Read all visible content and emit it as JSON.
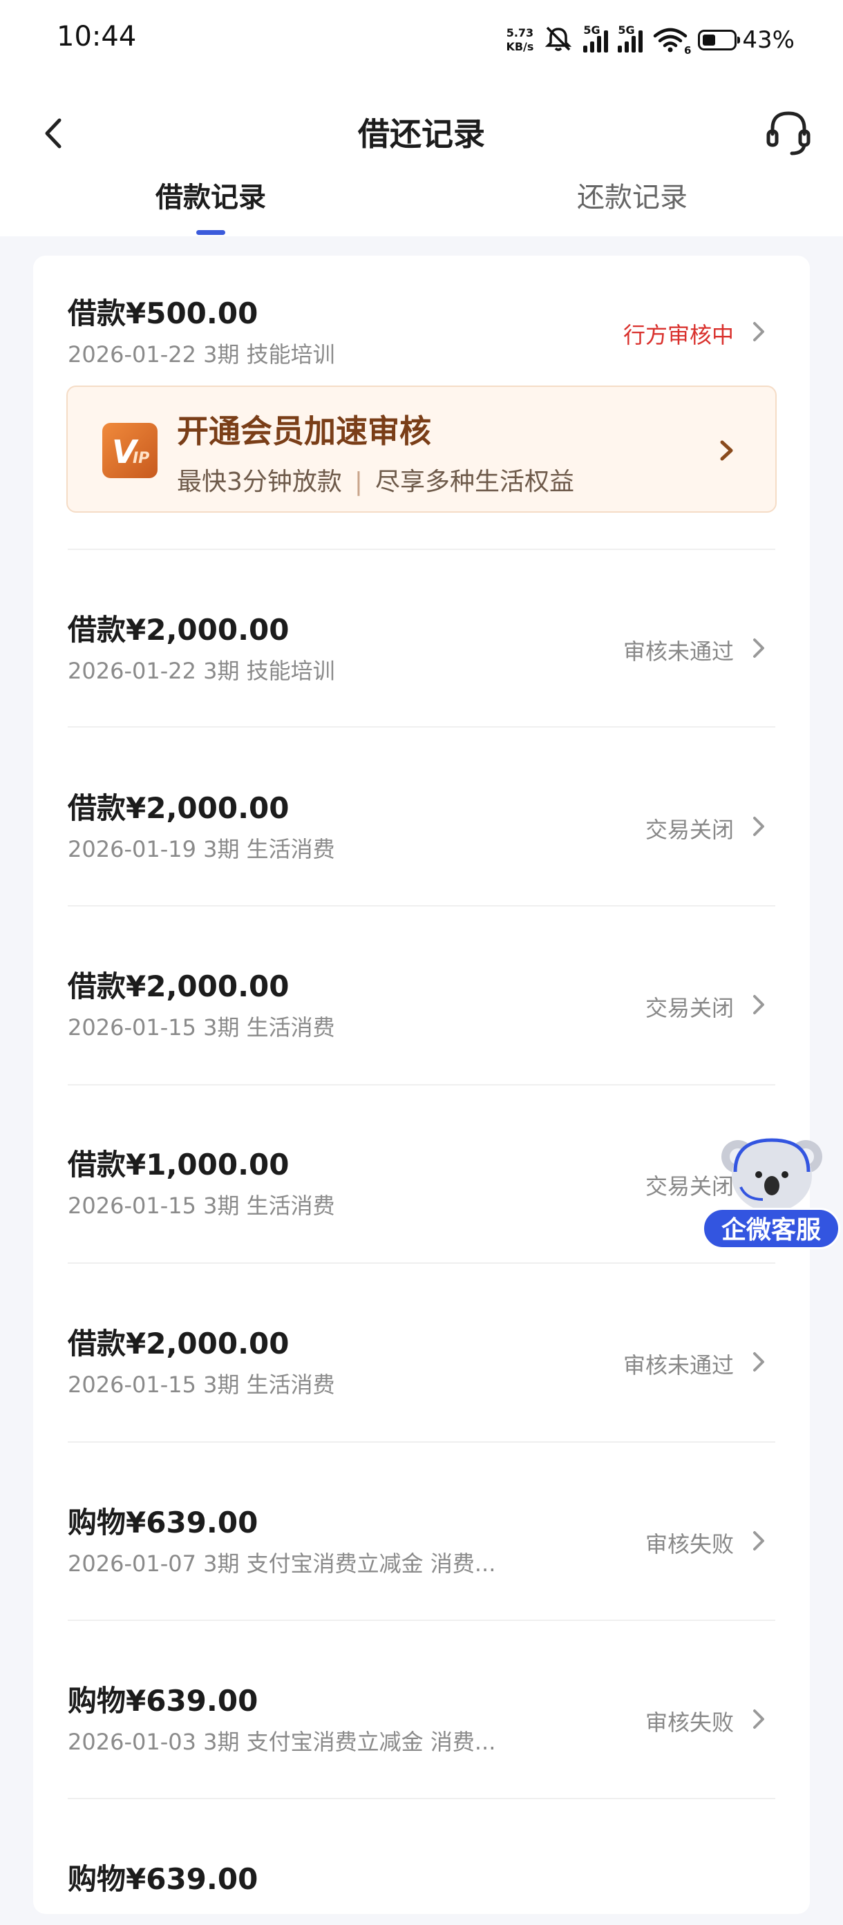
{
  "status_bar": {
    "time": "10:44",
    "net_speed_value": "5.73",
    "net_speed_unit": "KB/s",
    "signal_1_label": "5G",
    "signal_2_label": "5G",
    "wifi_label": "6",
    "battery_percent": "43%",
    "battery_level": 0.43
  },
  "header": {
    "title": "借还记录"
  },
  "tabs": [
    {
      "label": "借款记录",
      "active": true
    },
    {
      "label": "还款记录",
      "active": false
    }
  ],
  "vip_banner": {
    "badge_text": "VIP",
    "title": "开通会员加速审核",
    "subtitle_left": "最快3分钟放款",
    "subtitle_right": "尽享多种生活权益"
  },
  "records": [
    {
      "amount": "借款¥500.00",
      "meta": "2026-01-22 3期  技能培训",
      "status": "行方审核中"
    },
    {
      "amount": "借款¥2,000.00",
      "meta": "2026-01-22 3期  技能培训",
      "status": "审核未通过"
    },
    {
      "amount": "借款¥2,000.00",
      "meta": "2026-01-19 3期  生活消费",
      "status": "交易关闭"
    },
    {
      "amount": "借款¥2,000.00",
      "meta": "2026-01-15 3期  生活消费",
      "status": "交易关闭"
    },
    {
      "amount": "借款¥1,000.00",
      "meta": "2026-01-15 3期  生活消费",
      "status": "交易关闭"
    },
    {
      "amount": "借款¥2,000.00",
      "meta": "2026-01-15 3期  生活消费",
      "status": "审核未通过"
    },
    {
      "amount": "购物¥639.00",
      "meta": "2026-01-07 3期  支付宝消费立减金 消费...",
      "status": "审核失败"
    },
    {
      "amount": "购物¥639.00",
      "meta": "2026-01-03 3期  支付宝消费立减金 消费...",
      "status": "审核失败"
    },
    {
      "amount": "购物¥639.00",
      "meta": "",
      "status": ""
    }
  ],
  "floating_service": {
    "label": "企微客服"
  },
  "colors": {
    "accent": "#3b5bdb",
    "pending_status": "#d9302c",
    "vip_orange": "#e0782e"
  }
}
